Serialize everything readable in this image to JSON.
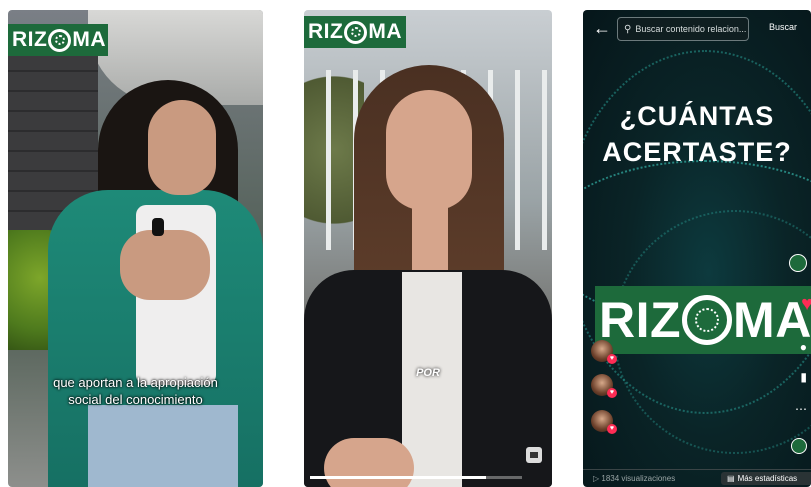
{
  "panel1": {
    "logo": {
      "left": "RIZ",
      "right": "MA"
    },
    "caption": {
      "line1": "que aportan a la apropiación",
      "line2": "social del conocimiento"
    }
  },
  "panel2": {
    "logo": {
      "left": "RIZ",
      "right": "MA"
    },
    "subtitle": "POR",
    "progress": 0.83
  },
  "panel3": {
    "search": {
      "placeholder": "Buscar contenido relacion...",
      "button": "Buscar"
    },
    "headline": {
      "line1": "¿CUÁNTAS",
      "line2": "ACERTASTE?"
    },
    "logo": {
      "left": "RIZ",
      "right": "MA"
    },
    "footer": {
      "views": "1834 visualizaciones",
      "stats_button": "Más estadísticas"
    },
    "colors": {
      "like": "#fe2c55",
      "brand_green": "#1d6a3b",
      "accent_teal": "#3ed6c8"
    }
  }
}
